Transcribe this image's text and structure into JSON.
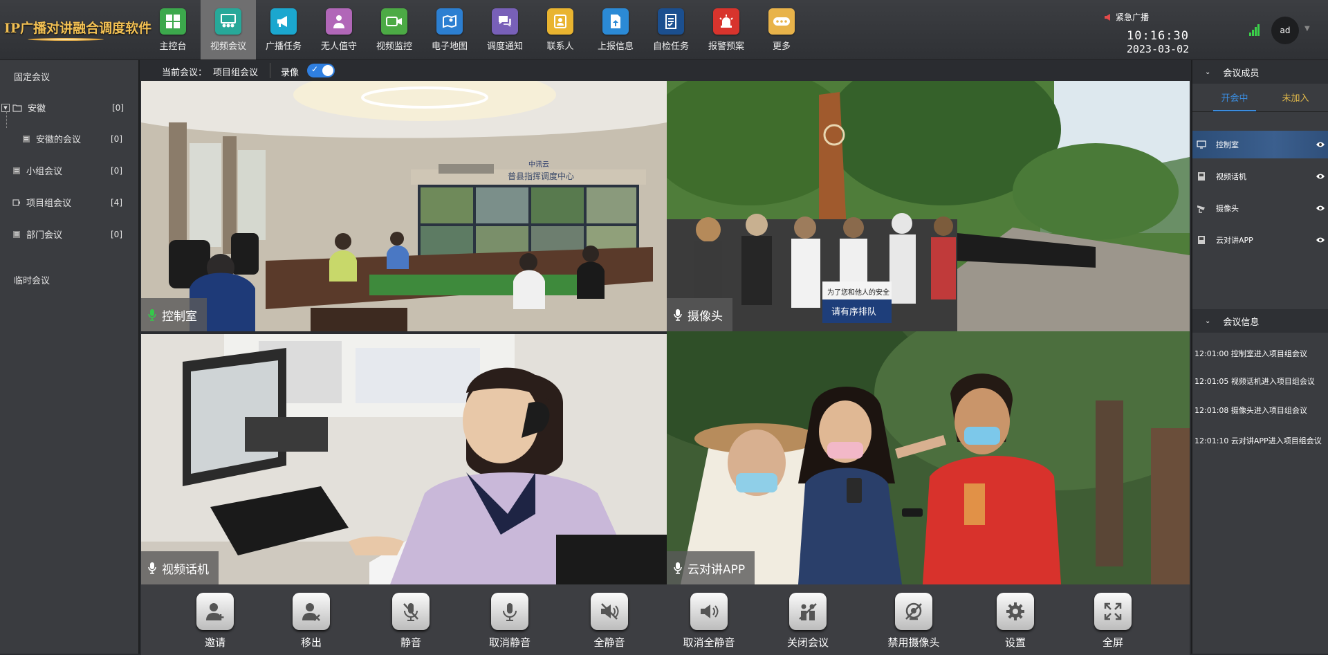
{
  "app": {
    "title": "IP广播对讲融合调度软件"
  },
  "nav": [
    {
      "label": "主控台",
      "icon": "dashboard-icon",
      "color": "#3ca84c",
      "active": false
    },
    {
      "label": "视频会议",
      "icon": "video-meeting-icon",
      "color": "#27a899",
      "active": true
    },
    {
      "label": "广播任务",
      "icon": "megaphone-icon",
      "color": "#1ba7cf",
      "active": false
    },
    {
      "label": "无人值守",
      "icon": "person-icon",
      "color": "#b167b8",
      "active": false
    },
    {
      "label": "视频监控",
      "icon": "camera-icon",
      "color": "#4caa45",
      "active": false
    },
    {
      "label": "电子地图",
      "icon": "map-icon",
      "color": "#2c7fd1",
      "active": false
    },
    {
      "label": "调度通知",
      "icon": "chat-icon",
      "color": "#7860b8",
      "active": false
    },
    {
      "label": "联系人",
      "icon": "contacts-icon",
      "color": "#e9b430",
      "active": false
    },
    {
      "label": "上报信息",
      "icon": "upload-doc-icon",
      "color": "#2b8ad6",
      "active": false
    },
    {
      "label": "自检任务",
      "icon": "checklist-icon",
      "color": "#1b4f8f",
      "active": false
    },
    {
      "label": "报警预案",
      "icon": "alarm-icon",
      "color": "#d8342d",
      "active": false
    },
    {
      "label": "更多",
      "icon": "more-icon",
      "color": "#e8b34a",
      "active": false
    }
  ],
  "header_right": {
    "emergency_label": "紧急广播",
    "time": "10:16:30",
    "date": "2023-03-02",
    "user": "ad"
  },
  "left_panel": {
    "fixed_title": "固定会议",
    "tree": [
      {
        "label": "安徽",
        "count": "[0]"
      },
      {
        "label": "安徽的会议",
        "count": "[0]"
      },
      {
        "label": "小组会议",
        "count": "[0]"
      },
      {
        "label": "项目组会议",
        "count": "[4]"
      },
      {
        "label": "部门会议",
        "count": "[0]"
      }
    ],
    "temp_title": "临时会议"
  },
  "main": {
    "current_meeting_label": "当前会议：",
    "current_meeting": "项目组会议",
    "record_label": "录像",
    "record_on": true,
    "tiles": [
      {
        "label": "控制室",
        "mic": "active"
      },
      {
        "label": "摄像头",
        "mic": "normal"
      },
      {
        "label": "视频话机",
        "mic": "normal"
      },
      {
        "label": "云对讲APP",
        "mic": "normal"
      }
    ],
    "tile1_signs": {
      "center_sign": "普县指挥调度中心",
      "brand": "中讯云"
    },
    "tile2_signs": {
      "line1": "为了您和他人的安全",
      "line2": "请有序排队"
    }
  },
  "toolbar": [
    {
      "label": "邀请",
      "icon": "invite-user-icon"
    },
    {
      "label": "移出",
      "icon": "remove-user-icon"
    },
    {
      "label": "静音",
      "icon": "mic-mute-icon"
    },
    {
      "label": "取消静音",
      "icon": "mic-icon"
    },
    {
      "label": "全静音",
      "icon": "speaker-mute-icon"
    },
    {
      "label": "取消全静音",
      "icon": "speaker-on-icon"
    },
    {
      "label": "关闭会议",
      "icon": "close-meeting-icon"
    },
    {
      "label": "禁用摄像头",
      "icon": "camera-off-icon"
    },
    {
      "label": "设置",
      "icon": "gear-icon"
    },
    {
      "label": "全屏",
      "icon": "fullscreen-icon"
    }
  ],
  "right_panel": {
    "members_title": "会议成员",
    "tab_active": "开会中",
    "tab_inactive": "未加入",
    "members": [
      {
        "label": "控制室",
        "icon": "monitor-icon",
        "active": true
      },
      {
        "label": "视频话机",
        "icon": "videophone-icon",
        "active": false
      },
      {
        "label": "摄像头",
        "icon": "cctv-icon",
        "active": false
      },
      {
        "label": "云对讲APP",
        "icon": "phone-app-icon",
        "active": false
      }
    ],
    "info_title": "会议信息",
    "logs": [
      "12:01:00 控制室进入项目组会议",
      "12:01:05 视频话机进入项目组会议",
      "12:01:08 摄像头进入项目组会议",
      "12:01:10 云对讲APP进入项目组会议"
    ]
  },
  "colors": {
    "accent": "#2f7fe0",
    "active_nav": "#6f6f70",
    "tab_active": "#3b8de0",
    "tab_inactive": "#e0b84a",
    "emergency": "#e24a4a"
  }
}
